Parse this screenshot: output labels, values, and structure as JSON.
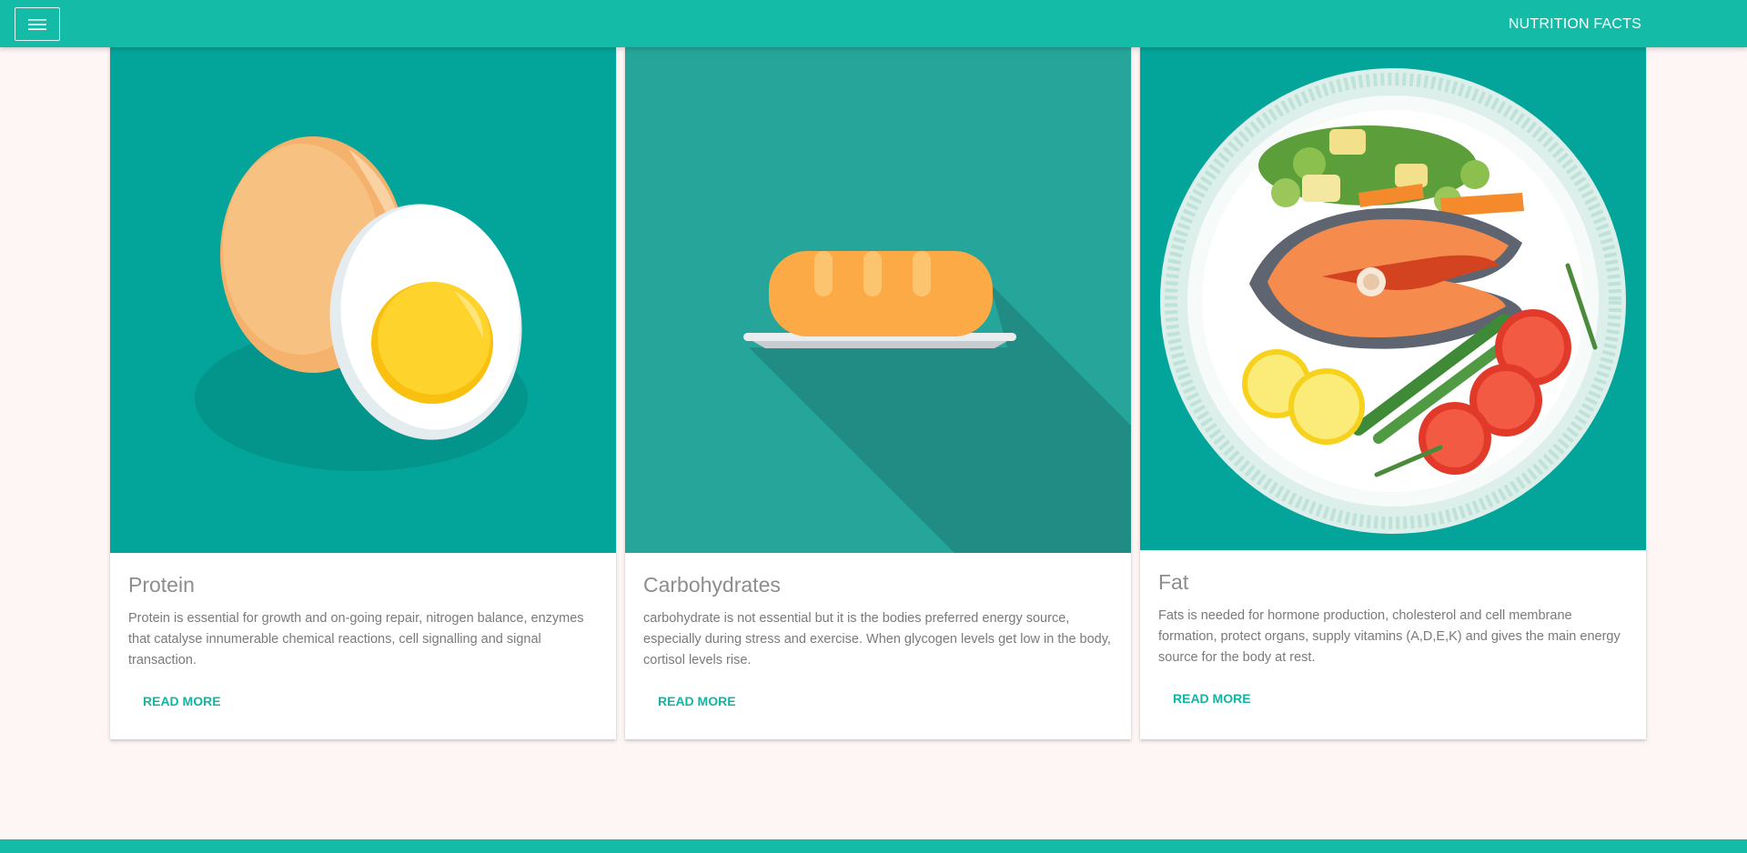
{
  "navbar": {
    "brand": "NUTRITION FACTS",
    "menu_icon": "hamburger-menu-icon",
    "color": "#14bba6"
  },
  "cards": [
    {
      "title": "Protein",
      "text": "Protein is essential for growth and on-going repair, nitrogen balance, enzymes that catalyse innumerable chemical reactions, cell signalling and signal transaction.",
      "action": "READ MORE",
      "image_icon": "egg-icon"
    },
    {
      "title": "Carbohydrates",
      "text": "carbohydrate is not essential but it is the bodies preferred energy source, especially during stress and exercise. When glycogen levels get low in the body, cortisol levels rise.",
      "action": "READ MORE",
      "image_icon": "bread-icon"
    },
    {
      "title": "Fat",
      "text": "Fats is needed for hormone production, cholesterol and cell membrane formation, protect organs, supply vitamins (A,D,E,K) and gives the main energy source for the body at rest.",
      "action": "READ MORE",
      "image_icon": "salmon-plate-icon"
    }
  ],
  "colors": {
    "accent": "#14bba6",
    "background": "#fdf6f5",
    "card_image_bg": "#03a59a",
    "link": "#13b4a2"
  }
}
